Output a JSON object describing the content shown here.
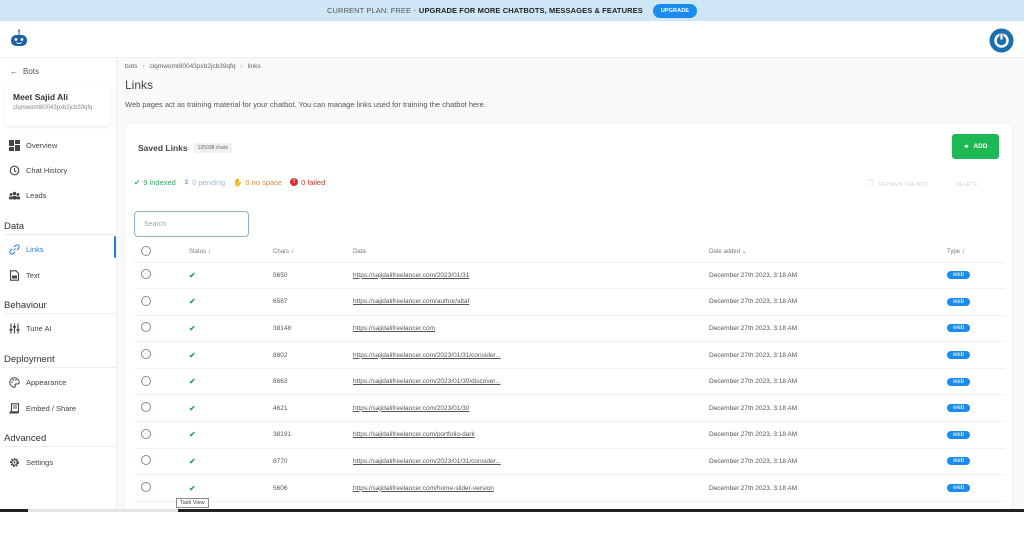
{
  "banner": {
    "plan_text": "CURRENT PLAN: FREE -",
    "upsell_text": "UPGRADE FOR MORE CHATBOTS, MESSAGES & FEATURES",
    "upgrade_label": "UPGRADE"
  },
  "sidebar": {
    "back_label": "Bots",
    "bot_name": "Meet Sajid Ali",
    "bot_id": "clqmwomt80043pxb2jcb39qfq",
    "items_top": [
      {
        "label": "Overview",
        "icon": "dashboard-icon"
      },
      {
        "label": "Chat History",
        "icon": "history-icon"
      },
      {
        "label": "Leads",
        "icon": "users-icon"
      }
    ],
    "sections": [
      {
        "title": "Data",
        "items": [
          {
            "label": "Links",
            "icon": "link-icon",
            "active": true
          },
          {
            "label": "Text",
            "icon": "document-icon"
          }
        ]
      },
      {
        "title": "Behaviour",
        "items": [
          {
            "label": "Tune AI",
            "icon": "sliders-icon"
          }
        ]
      },
      {
        "title": "Deployment",
        "items": [
          {
            "label": "Appearance",
            "icon": "palette-icon"
          },
          {
            "label": "Embed / Share",
            "icon": "embed-icon"
          }
        ]
      },
      {
        "title": "Advanced",
        "items": [
          {
            "label": "Settings",
            "icon": "gear-icon"
          }
        ]
      }
    ]
  },
  "breadcrumb": [
    "bots",
    "clqmwomt80043pxb2jcb39qfq",
    "links"
  ],
  "page": {
    "title": "Links",
    "description": "Web pages act as training material for your chatbot. You can manage links used for training the chatbot here."
  },
  "card": {
    "title": "Saved Links",
    "chars_badge": "125038 chars",
    "add_label": "ADD",
    "retrain_label": "RETRAIN THE BOT",
    "delete_label": "DELETE",
    "stats": {
      "indexed": "9 indexed",
      "pending": "0 pending",
      "no_space": "0 no space",
      "failed": "0 failed"
    },
    "search_placeholder": "Search"
  },
  "table": {
    "headers": {
      "status": "Status",
      "chars": "Chars",
      "data": "Data",
      "date": "Date added",
      "type": "Type"
    },
    "rows": [
      {
        "chars": "5650",
        "url": "https://sajidalifreelancer.com/2023/01/31",
        "date": "December 27th 2023, 3:18 AM",
        "type": "web"
      },
      {
        "chars": "6587",
        "url": "https://sajidalifreelancer.com/author/altaf",
        "date": "December 27th 2023, 3:18 AM",
        "type": "web"
      },
      {
        "chars": "38148",
        "url": "https://sajidalifreelancer.com",
        "date": "December 27th 2023, 3:18 AM",
        "type": "web"
      },
      {
        "chars": "8802",
        "url": "https://sajidalifreelancer.com/2023/01/31/consider...",
        "date": "December 27th 2023, 3:18 AM",
        "type": "web"
      },
      {
        "chars": "8663",
        "url": "https://sajidalifreelancer.com/2023/01/30/discover...",
        "date": "December 27th 2023, 3:18 AM",
        "type": "web"
      },
      {
        "chars": "4621",
        "url": "https://sajidalifreelancer.com/2023/01/30",
        "date": "December 27th 2023, 3:18 AM",
        "type": "web"
      },
      {
        "chars": "38191",
        "url": "https://sajidalifreelancer.com/portfolio-dark",
        "date": "December 27th 2023, 3:18 AM",
        "type": "web"
      },
      {
        "chars": "8770",
        "url": "https://sajidalifreelancer.com/2023/01/31/consider...",
        "date": "December 27th 2023, 3:18 AM",
        "type": "web"
      },
      {
        "chars": "5606",
        "url": "https://sajidalifreelancer.com/home-slider-version",
        "date": "December 27th 2023, 3:18 AM",
        "type": "web"
      }
    ]
  },
  "tooltip": "Task View",
  "colors": {
    "accent": "#1a8cf0",
    "add": "#1db954",
    "success": "#33a35b",
    "failed": "#d63030"
  }
}
